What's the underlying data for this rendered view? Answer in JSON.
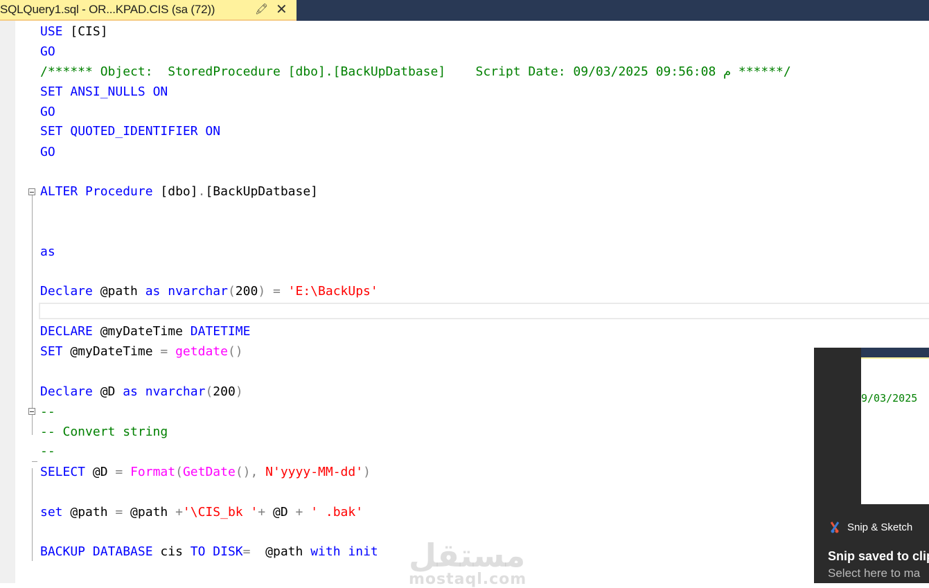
{
  "tab": {
    "title": "SQLQuery1.sql - OR...KPAD.CIS (sa (72))",
    "pin_icon": "pin-icon",
    "close_icon": "close-icon"
  },
  "code": {
    "line1": [
      "USE",
      " [CIS]"
    ],
    "line2": "GO",
    "line3": "/****** Object:  StoredProcedure [dbo].[BackUpDatbase]    Script Date: 09/03/2025 09:56:08 م ******/",
    "line4": [
      "SET",
      " ANSI_NULLS ",
      "ON"
    ],
    "line5": "GO",
    "line6": [
      "SET",
      " QUOTED_IDENTIFIER ",
      "ON"
    ],
    "line7": "GO",
    "line9": [
      "ALTER",
      " ",
      "Procedure",
      " [dbo]",
      ".",
      "[BackUpDatbase]"
    ],
    "line12": "as",
    "line14": [
      "Declare",
      " @path ",
      "as",
      " ",
      "nvarchar",
      "(",
      "200",
      ")",
      " = ",
      "'E:\\BackUps'"
    ],
    "line16": [
      "DECLARE",
      " @myDateTime ",
      "DATETIME"
    ],
    "line17": [
      "SET",
      " @myDateTime ",
      "=",
      " ",
      "getdate",
      "()"
    ],
    "line19": [
      "Declare",
      " @D ",
      "as",
      " ",
      "nvarchar",
      "(",
      "200",
      ")"
    ],
    "line20": "--",
    "line21": "-- Convert string",
    "line22": "--",
    "line23": [
      "SELECT",
      " @D ",
      "=",
      " ",
      "Format",
      "(",
      "GetDate",
      "(),",
      " ",
      "N'yyyy-MM-dd'",
      ")"
    ],
    "line25": [
      "set",
      " @path ",
      "=",
      " @path ",
      "+",
      "'\\CIS_bk '",
      "+",
      " @D ",
      "+",
      " ",
      "' .bak'"
    ],
    "line27": [
      "BACKUP",
      " ",
      "DATABASE",
      " cis ",
      "TO",
      " ",
      "DISK",
      "=",
      "  @path ",
      "with",
      " ",
      "init"
    ]
  },
  "watermark": {
    "arabic": "مستقل",
    "latin": "mostaql.com"
  },
  "toast": {
    "app_name": "Snip & Sketch",
    "title": "Snip saved to clip",
    "body": "Select here to ma",
    "thumbnail_text": "9/03/2025"
  },
  "colors": {
    "keyword": "#0000ff",
    "comment": "#008000",
    "string": "#ff0000",
    "function": "#ff00ff",
    "operator": "#808080",
    "tab_active": "#fff29d",
    "tab_strip": "#293955"
  }
}
